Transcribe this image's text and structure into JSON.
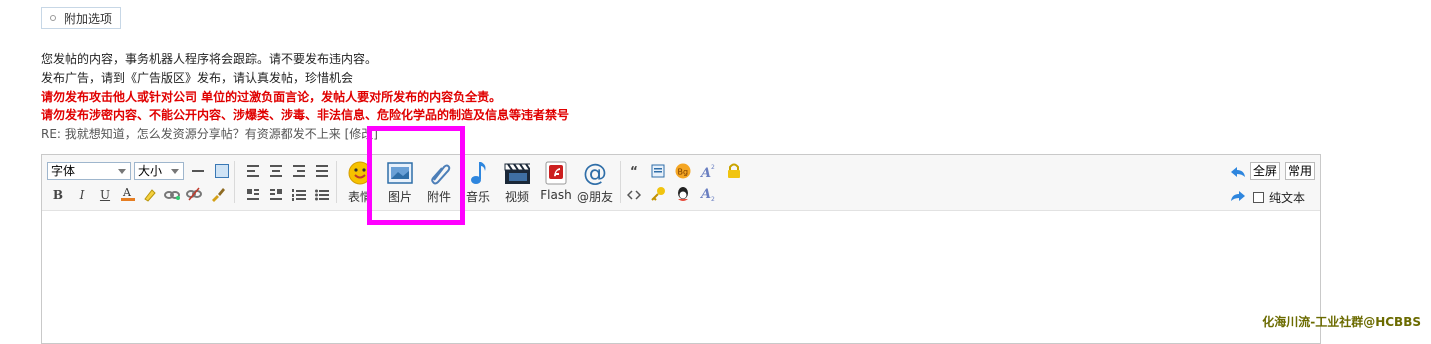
{
  "extra_options": {
    "label": "附加选项"
  },
  "notices": [
    "您发帖的内容，事务机器人程序将会跟踪。请不要发布违内容。",
    "发布广告，请到《广告版区》发布，请认真发帖，珍惜机会",
    "请勿发布攻击他人或针对公司 单位的过激负面言论，发帖人要对所发布的内容负全责。",
    "请勿发布涉密内容、不能公开内容、涉爆类、涉毒、非法信息、危险化学品的制造及信息等违者禁号"
  ],
  "reply": {
    "text": "RE: 我就想知道，怎么发资源分享帖？有资源都发不上来 [修改]"
  },
  "toolbar": {
    "font_select": "字体",
    "size_select": "大小",
    "emoji_label": "表情",
    "image_label": "图片",
    "attachment_label": "附件",
    "music_label": "音乐",
    "video_label": "视频",
    "flash_label": "Flash",
    "mention_label": "@朋友",
    "fullscreen_label": "全屏",
    "common_label": "常用",
    "plaintext_label": "纯文本"
  },
  "watermark": "化海川流-工业社群@HCBBS",
  "colors": {
    "highlight": "#ff00ff",
    "notice_red": "#e00000"
  }
}
